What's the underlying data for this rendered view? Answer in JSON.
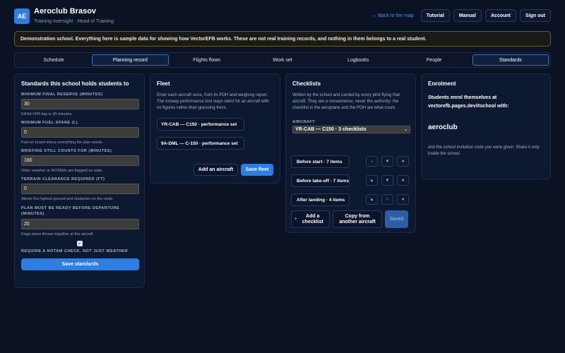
{
  "header": {
    "logo": "AE",
    "title": "Aeroclub Brasov",
    "subtitle": "Training oversight · Head of Training",
    "back_link": "← Back to the map",
    "buttons": [
      "Tutorial",
      "Manual",
      "Account",
      "Sign out"
    ]
  },
  "banner": "Demonstration school. Everything here is sample data for showing how VectorEFB works. These are not real training records, and nothing in them belongs to a real student.",
  "tabs": [
    {
      "label": "Schedule"
    },
    {
      "label": "Planning record"
    },
    {
      "label": "Flights flown"
    },
    {
      "label": "Work set"
    },
    {
      "label": "Logbooks"
    },
    {
      "label": "People"
    },
    {
      "label": "Standards"
    }
  ],
  "standards": {
    "title": "Standards this school holds students to",
    "fields": [
      {
        "label": "Minimum final reserve (minutes)",
        "value": "30",
        "hint": "EASA VFR day is 30 minutes."
      },
      {
        "label": "Minimum fuel spare (L)",
        "value": "0",
        "hint": "Fuel on board minus everything the plan needs."
      },
      {
        "label": "Briefing still counts for (minutes)",
        "value": "180",
        "hint": "Older weather or NOTAMs are flagged as stale."
      },
      {
        "label": "Terrain clearance required (ft)",
        "value": "0",
        "hint": "Above the highest ground and obstacles on the route."
      },
      {
        "label": "Plan must be ready before departure (minutes)",
        "value": "20",
        "hint": "Flags plans thrown together at the aircraft."
      }
    ],
    "notam_check_label": "Require a NOTAM check, not just weather",
    "notam_checked": true,
    "save_label": "Save standards"
  },
  "fleet": {
    "title": "Fleet",
    "description": "Enter each aircraft once, from its POH and weighing report. The runway performance tool stays silent for an aircraft with no figures rather than guessing them.",
    "aircraft": [
      "YR-CAB — C150 · performance set",
      "9A-DML — C-150 · performance set"
    ],
    "add_label": "Add an aircraft",
    "save_label": "Save fleet"
  },
  "checklists": {
    "title": "Checklists",
    "description": "Written by the school and carried by every pilot flying that aircraft. They are a convenience, never the authority: the checklist in the aeroplane and the POH are what count.",
    "aircraft_label": "Aircraft",
    "aircraft_selected": "YR-CAB — C150 · 3 checklists",
    "items": [
      "Before start · 7 items",
      "Before take-off · 7 items",
      "After landing · 4 items"
    ],
    "add_label": "Add a checklist",
    "copy_label": "Copy from another aircraft",
    "saved_label": "Saved"
  },
  "enrolment": {
    "title": "Enrolment",
    "intro": "Students enrol themselves at vectorefb.pages.dev/#school with:",
    "code": "aeroclub",
    "note": "and the school invitation code you were given. Share it only inside the school."
  }
}
